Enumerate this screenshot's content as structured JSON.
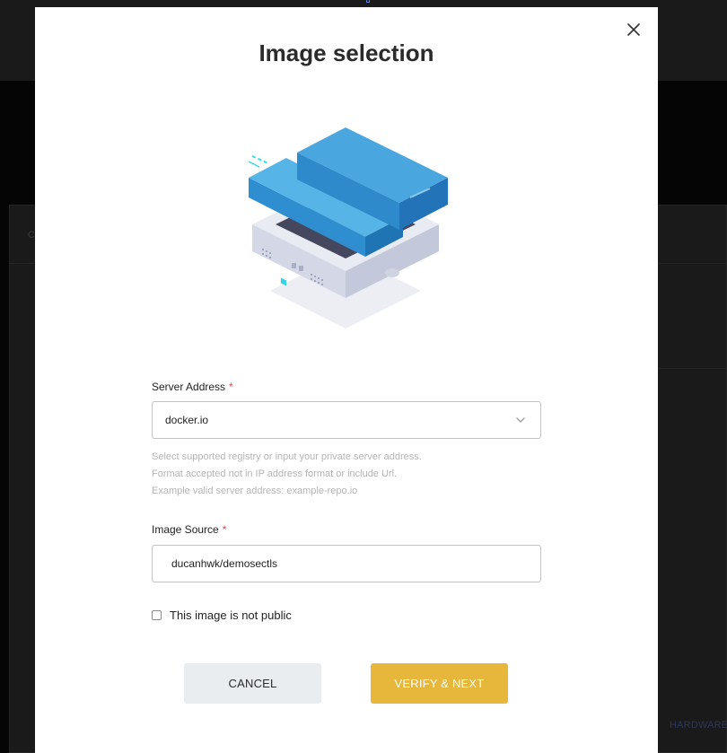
{
  "background": {
    "left_label": "C",
    "hardware_label": "HARDWARE"
  },
  "modal": {
    "title": "Image selection",
    "close_icon": "close-icon",
    "illustration_icon": "server-illustration",
    "server_address": {
      "label": "Server Address",
      "required_mark": "*",
      "value": "docker.io",
      "help_lines": [
        "Select supported registry or input your private server address.",
        "Format accepted not in IP address format or include Url.",
        "Example valid server address: example-repo.io"
      ]
    },
    "image_source": {
      "label": "Image Source",
      "required_mark": "*",
      "value": "ducanhwk/demosectls"
    },
    "not_public_checkbox": {
      "label": "This image is not public",
      "checked": false
    },
    "buttons": {
      "cancel": "CANCEL",
      "verify": "VERIFY & NEXT"
    }
  },
  "colors": {
    "primary": "#e6b73a",
    "required": "#e5484d",
    "secondary_button": "#e9edf0"
  }
}
